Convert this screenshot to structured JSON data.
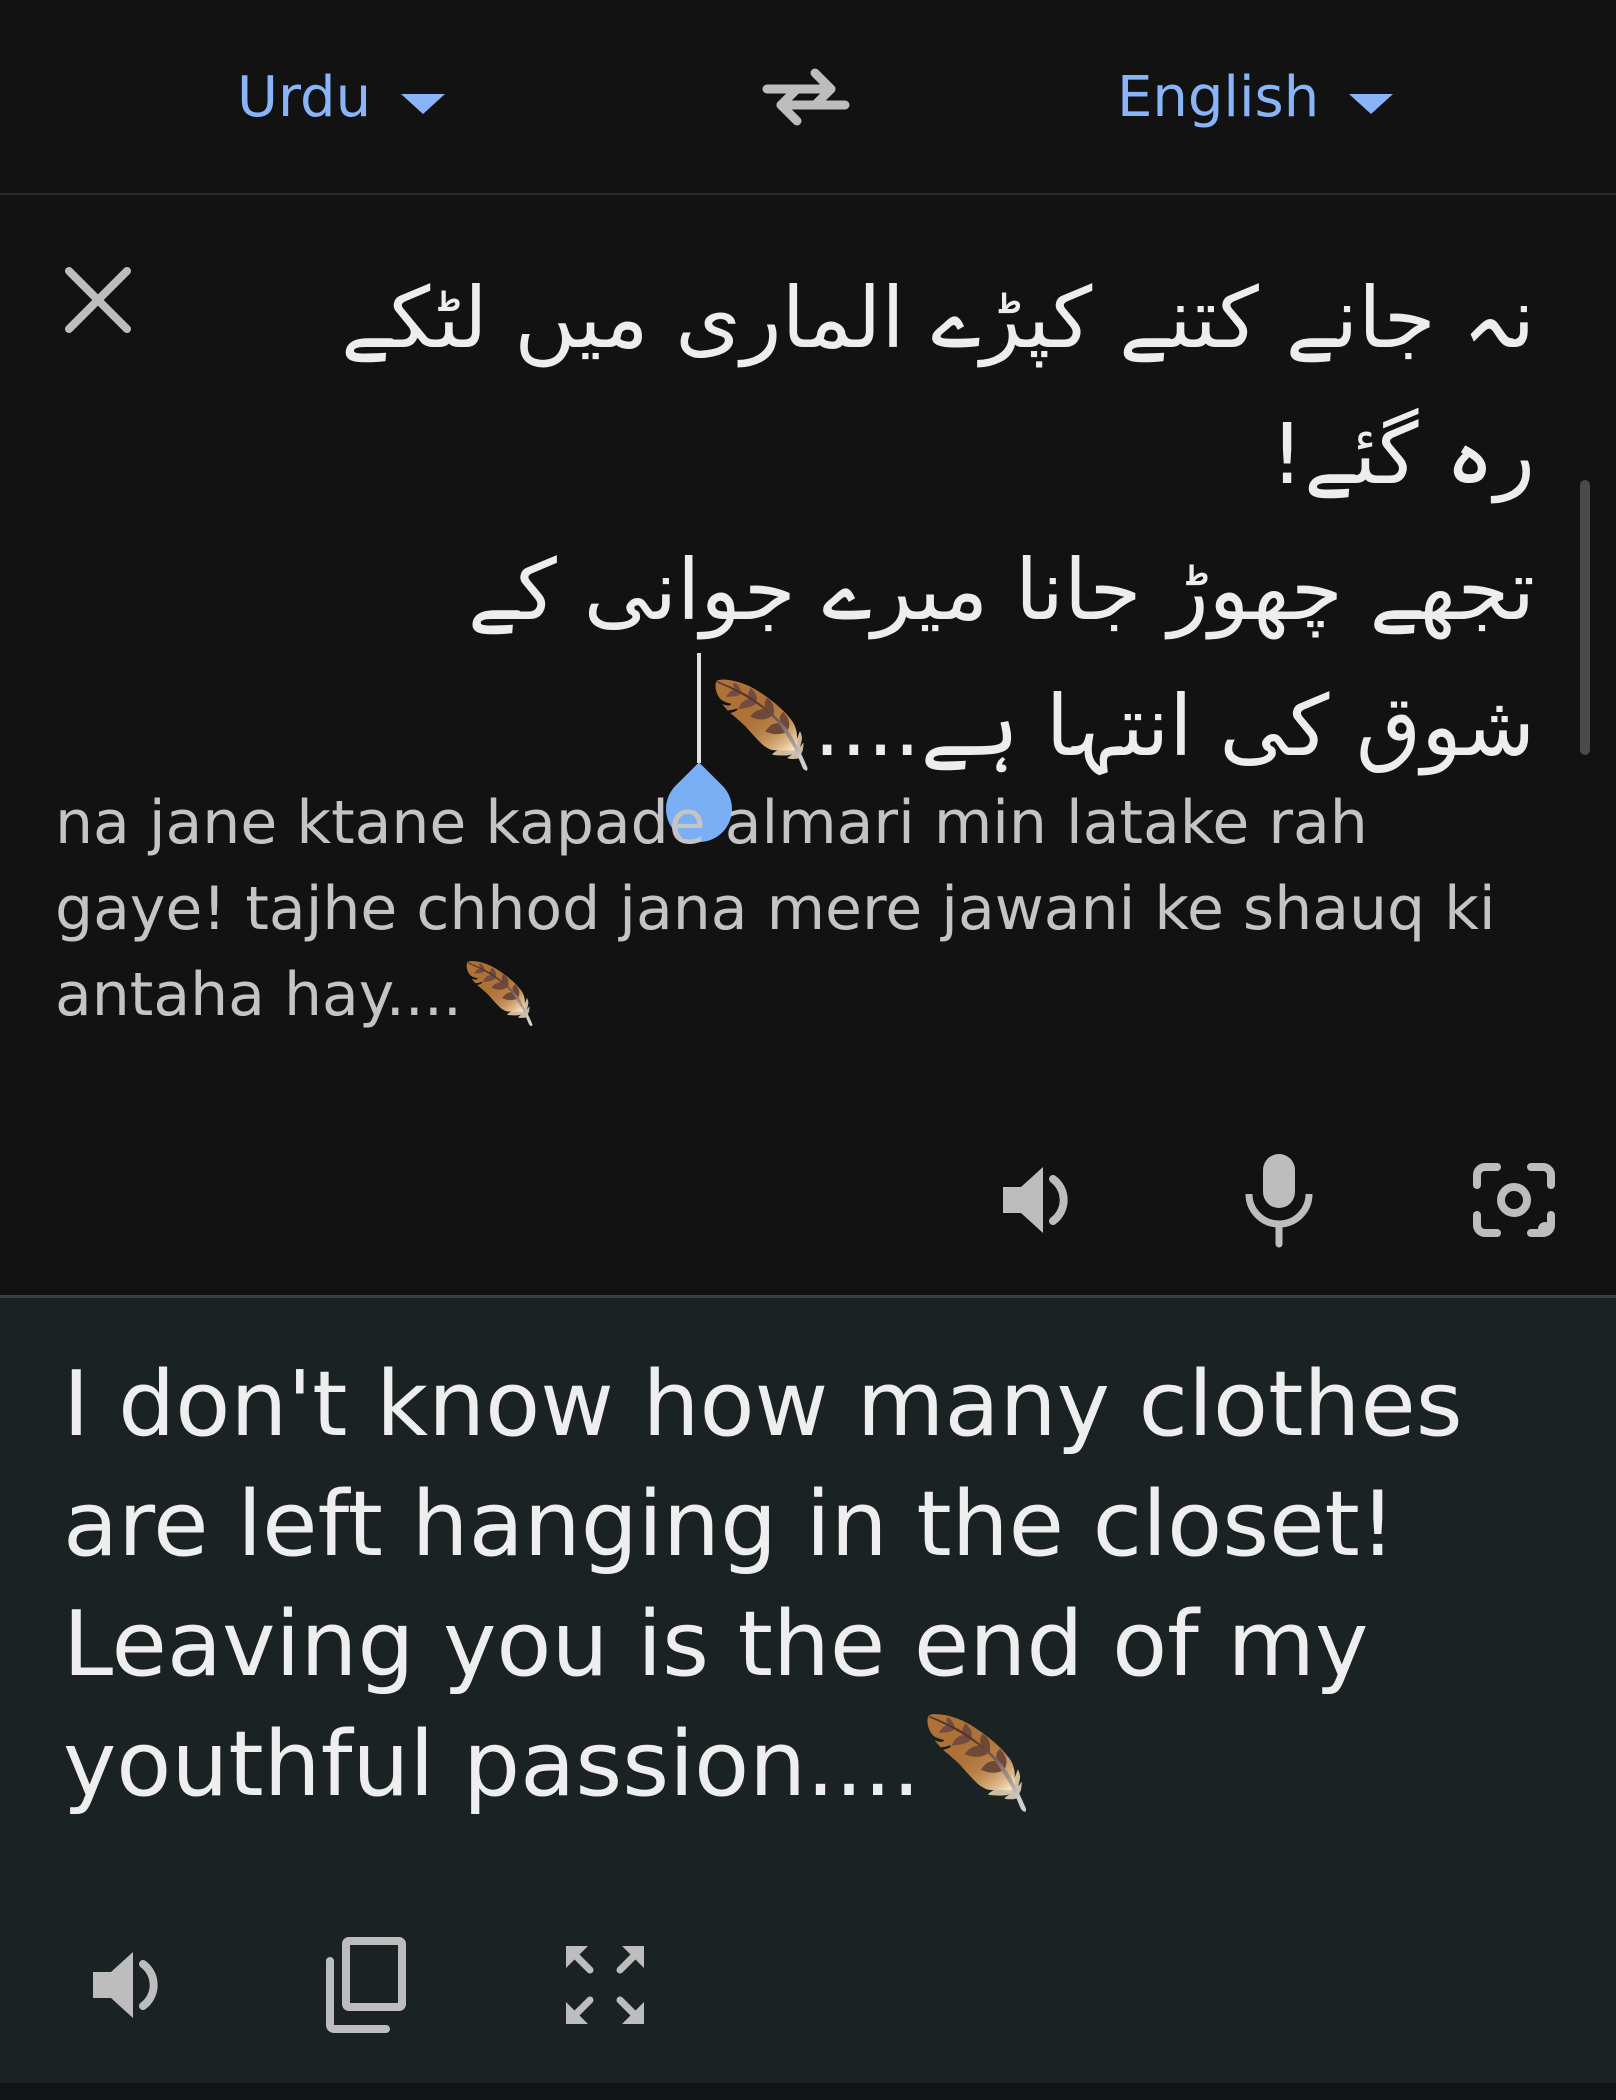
{
  "language_bar": {
    "source_language": "Urdu",
    "target_language": "English",
    "swap_icon": "swap-arrows-icon"
  },
  "input": {
    "urdu_lines": [
      "نہ جانے کتنے کپڑے الماری میں لٹکے",
      "رہ گئے!",
      "تجھے چھوڑ جانا میرے جوانی کے",
      "شوق کی انتہا ہے....🪶"
    ],
    "transliteration": "na jane ktane kapade almari min latake rah gaye! tajhe chhod jana mere jawani ke shauq ki antaha hay....🪶",
    "icons": {
      "clear": "close-icon",
      "listen": "speaker-icon",
      "voice": "microphone-icon",
      "camera": "camera-icon"
    }
  },
  "output": {
    "translation": "I don't know how many clothes are left hanging in the closet! Leaving you is the end of my youthful passion....🪶",
    "icons": {
      "listen": "speaker-icon",
      "copy": "copy-icon",
      "fullscreen": "fullscreen-icon"
    }
  },
  "colors": {
    "background": "#121212",
    "output_background": "#1b2223",
    "accent": "#8ab4f8",
    "cursor_handle": "#7aaef5"
  }
}
